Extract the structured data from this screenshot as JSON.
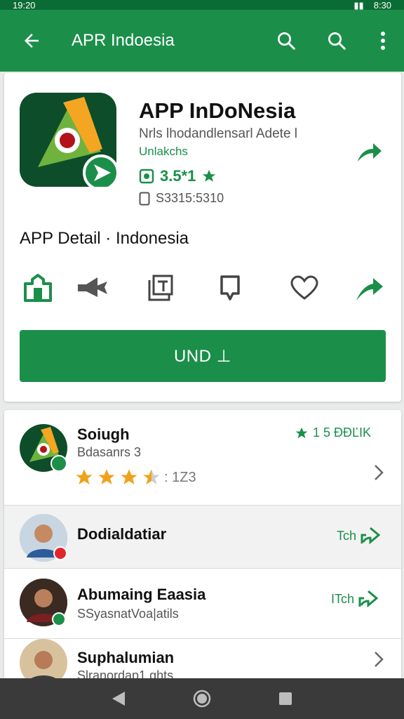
{
  "status_bar": {
    "time_left": "19:20",
    "time_right": "8:30"
  },
  "app_bar": {
    "title": "APR Indoesia",
    "icons": [
      "back-arrow-icon",
      "search-icon",
      "search-icon",
      "more-vert-icon"
    ]
  },
  "app": {
    "name": "APP InDoNesia",
    "subtitle": "Nrls lhodandlensarl Adete l",
    "developer": "Unlakchs",
    "rating": "3.5*1",
    "size": "S3315:5310",
    "detail_title": "APP Detail · Indonesia",
    "install_label": "UND ⊥"
  },
  "action_icons": [
    "store-icon",
    "megaphone-icon",
    "document-icon",
    "bookmark-icon",
    "heart-icon",
    "share-icon"
  ],
  "list": [
    {
      "name": "Soiugh",
      "sub": "Bdasanrs 3",
      "rating_text": "1 5 ĐĐĽIK",
      "stars_text": ": 1Z3",
      "stars": 3.5
    },
    {
      "name": "Dodialdatiar",
      "right_text": "Tch"
    },
    {
      "name": "Abumaing Eaasia",
      "sub": "SSyasnatVoa|atils",
      "right_text": "ITch"
    },
    {
      "name": "Suphalumian",
      "sub": "Slranordap1 ghts"
    }
  ],
  "colors": {
    "primary": "#1b8f4a",
    "dark": "#0b6b34",
    "star": "#f0a21a"
  }
}
